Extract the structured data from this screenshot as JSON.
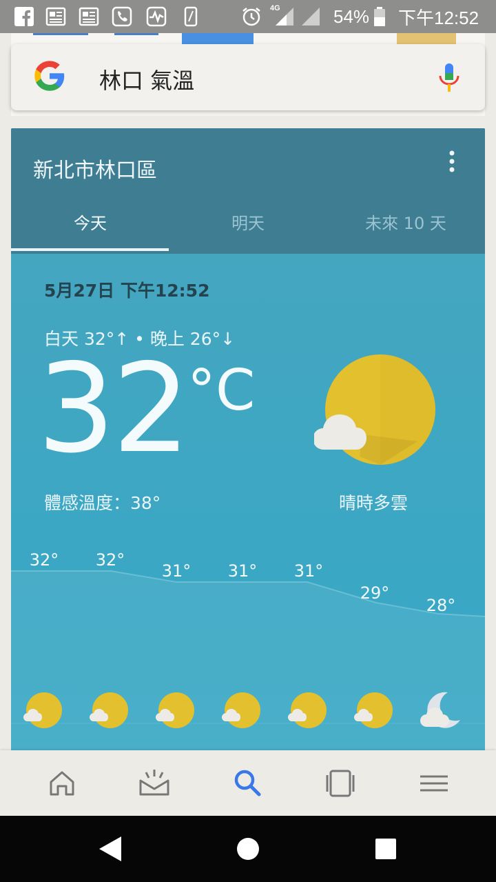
{
  "status_bar": {
    "battery": "54%",
    "time": "下午12:52",
    "network": "4G",
    "left_icons": [
      "facebook-icon",
      "news-icon",
      "news-icon",
      "phone-settings-icon",
      "pulse-icon",
      "phone-icon"
    ],
    "right_icons": [
      "alarm-icon",
      "signal-icon",
      "signal-icon",
      "battery-icon"
    ]
  },
  "search": {
    "query": "林口 氣溫"
  },
  "weather": {
    "location": "新北市林口區",
    "tabs": [
      {
        "label": "今天",
        "active": true
      },
      {
        "label": "明天",
        "active": false
      },
      {
        "label": "未來 10 天",
        "active": false
      }
    ],
    "datetime": "5月27日 下午12:52",
    "day_night": "白天 32°↑ • 晚上 26°↓",
    "temperature": "32",
    "unit": "°C",
    "feels_like": "體感溫度：38°",
    "condition": "晴時多雲",
    "hourly_temps": [
      "32°",
      "32°",
      "31°",
      "31°",
      "31°",
      "29°",
      "28°"
    ],
    "hourly_icons": [
      "partly-cloudy-sun-icon",
      "partly-cloudy-sun-icon",
      "partly-cloudy-sun-icon",
      "partly-cloudy-sun-icon",
      "partly-cloudy-sun-icon",
      "partly-cloudy-sun-icon",
      "partly-cloudy-moon-icon"
    ]
  },
  "bottom_nav": {
    "items": [
      "home-icon",
      "updates-icon",
      "search-icon",
      "tabs-icon",
      "menu-icon"
    ],
    "active": "search-icon",
    "active_color": "#3b78e7"
  },
  "colors": {
    "sun": "#e3c02e",
    "header": "#3f7d92",
    "card": "#3ea7c3"
  }
}
